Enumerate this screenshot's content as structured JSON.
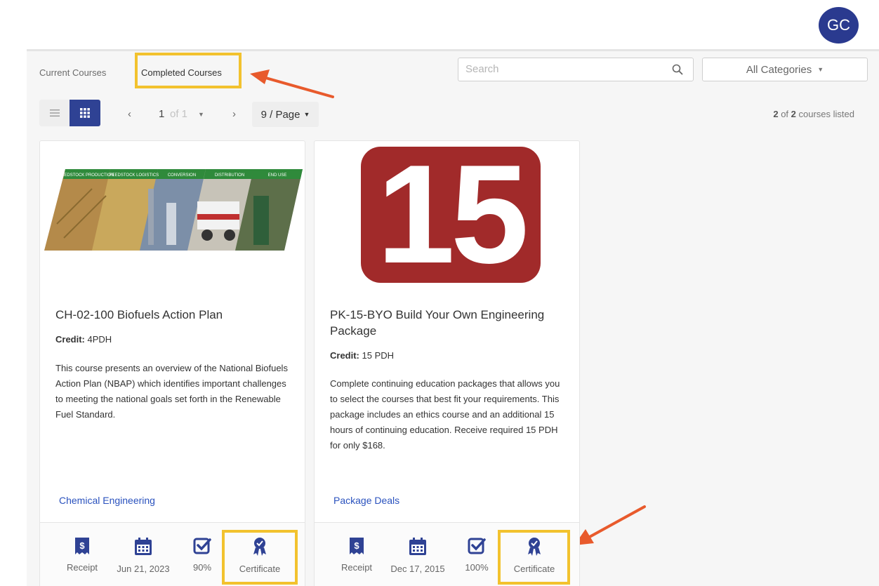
{
  "user": {
    "initials": "GC"
  },
  "tabs": {
    "current": "Current Courses",
    "completed": "Completed Courses"
  },
  "search": {
    "placeholder": "Search"
  },
  "filter": {
    "category": "All Categories"
  },
  "pagination": {
    "page": "1",
    "of": "of 1",
    "per_page": "9 / Page"
  },
  "listing": {
    "shown": "2",
    "mid": " of ",
    "total": "2",
    "suffix": " courses listed"
  },
  "colors": {
    "accent": "#2f4294",
    "highlight": "#f2c22e",
    "arrow": "#e85a2c",
    "badge": "#a12a2a",
    "link": "#2a52be"
  },
  "courses": [
    {
      "image_labels": [
        "FEEDSTOCK PRODUCTION",
        "FEEDSTOCK LOGISTICS",
        "CONVERSION",
        "DISTRIBUTION",
        "END USE"
      ],
      "title": "CH-02-100 Biofuels Action Plan",
      "credit_label": "Credit:",
      "credit": " 4PDH",
      "description": "This course presents an overview of the National Biofuels Action Plan (NBAP) which identifies important challenges to meeting the national goals set forth in the Renewable Fuel Standard.",
      "category": "Chemical Engineering",
      "receipt": "Receipt",
      "date": "Jun 21, 2023",
      "score": "90%",
      "certificate": "Certificate"
    },
    {
      "image_text": "15",
      "title": "PK-15-BYO Build Your Own Engineering Package",
      "credit_label": "Credit:",
      "credit": " 15 PDH",
      "description": "Complete continuing education packages that allows you to select the courses that best fit your requirements. This package includes an ethics course and an additional 15 hours of continuing education. Receive required 15 PDH for only $168.",
      "category": "Package Deals",
      "receipt": "Receipt",
      "date": "Dec 17, 2015",
      "score": "100%",
      "certificate": "Certificate"
    }
  ]
}
